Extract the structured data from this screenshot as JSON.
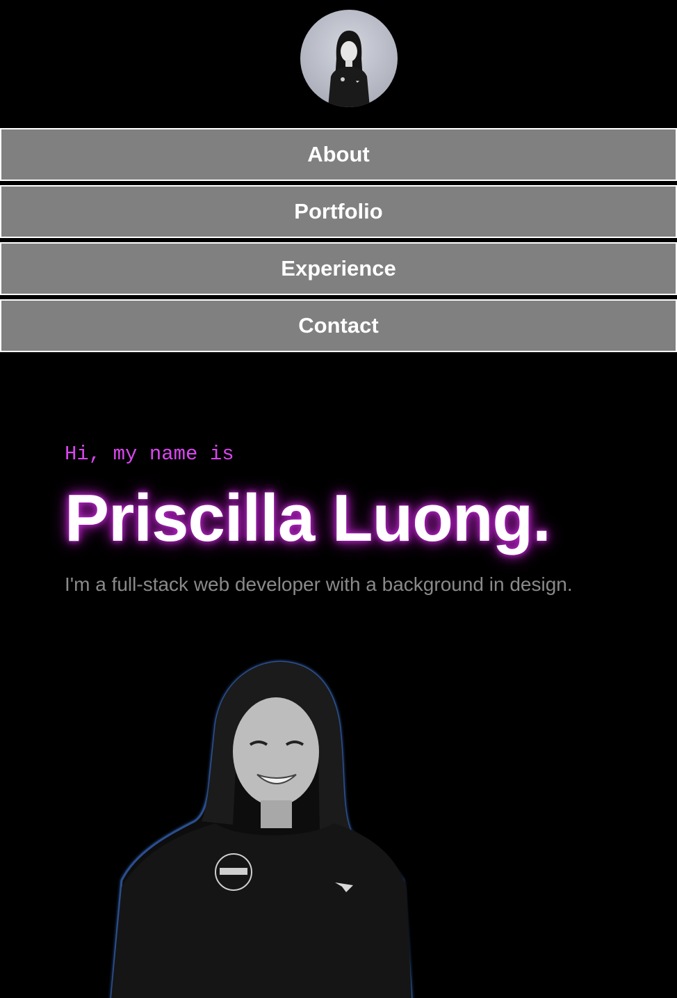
{
  "header": {
    "avatar_icon": "profile-photo"
  },
  "nav": {
    "items": [
      {
        "label": "About"
      },
      {
        "label": "Portfolio"
      },
      {
        "label": "Experience"
      },
      {
        "label": "Contact"
      }
    ]
  },
  "hero": {
    "intro": "Hi, my name is",
    "name": "Priscilla Luong.",
    "tagline": "I'm a full-stack web developer with a background in design.",
    "portrait_icon": "portrait-photo"
  },
  "colors": {
    "background": "#000000",
    "nav_bg": "#808080",
    "accent": "#d946ef",
    "tagline": "#8a8a8a"
  }
}
